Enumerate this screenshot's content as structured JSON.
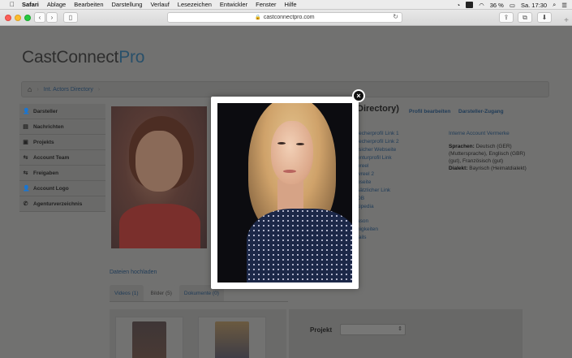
{
  "menubar": {
    "apple": "",
    "items": [
      "Safari",
      "Ablage",
      "Bearbeiten",
      "Darstellung",
      "Verlauf",
      "Lesezeichen",
      "Entwickler",
      "Fenster",
      "Hilfe"
    ],
    "battery": "36 %",
    "clock": "Sa. 17:30"
  },
  "browser": {
    "url": "castconnectpro.com"
  },
  "site": {
    "logo_main": "CastConnect",
    "logo_accent": "Pro"
  },
  "breadcrumb": {
    "item": "Int. Actors Directory"
  },
  "sidebar": {
    "items": [
      {
        "label": "Darsteller",
        "icon": "user-icon",
        "glyph": "👤"
      },
      {
        "label": "Nachrichten",
        "icon": "inbox-icon",
        "glyph": "▤"
      },
      {
        "label": "Projekts",
        "icon": "folder-icon",
        "glyph": "▣"
      },
      {
        "label": "Account Team",
        "icon": "share-icon",
        "glyph": "⇆"
      },
      {
        "label": "Freigaben",
        "icon": "share-icon",
        "glyph": "⇆"
      },
      {
        "label": "Account Logo",
        "icon": "user-icon",
        "glyph": "👤"
      },
      {
        "label": "Agenturverzeichnis",
        "icon": "phone-icon",
        "glyph": "✆"
      }
    ]
  },
  "profile": {
    "heading": "Directory)",
    "edit_link": "Profil bearbeiten",
    "access_link": "Darsteller-Zugang",
    "links": [
      "recherprofil Link 1",
      "recherprofil Link 2",
      "rsicher Webseite",
      "enturprofil Link",
      "ereel",
      "wreel 2",
      "bseite",
      "sätzlicher Link",
      "DB",
      "kipedia",
      "",
      "ason",
      "nigkeiten",
      "tails"
    ],
    "vermerke": "Interne Account Vermerke",
    "sprachen_label": "Sprachen:",
    "sprachen_value": "Deutsch (GER) (Muttersprache), Englisch (GBR) (gut), Französisch (gut)",
    "dialekt_label": "Dialekt:",
    "dialekt_value": "Bayrisch (Heimatdialekt)"
  },
  "files": {
    "upload_link": "Dateien hochladen",
    "tabs": [
      "Videos (1)",
      "Bilder (5)",
      "Dokumente (0)"
    ]
  },
  "projekt": {
    "label": "Projekt",
    "selected": ""
  },
  "lightbox": {
    "close_glyph": "×"
  }
}
